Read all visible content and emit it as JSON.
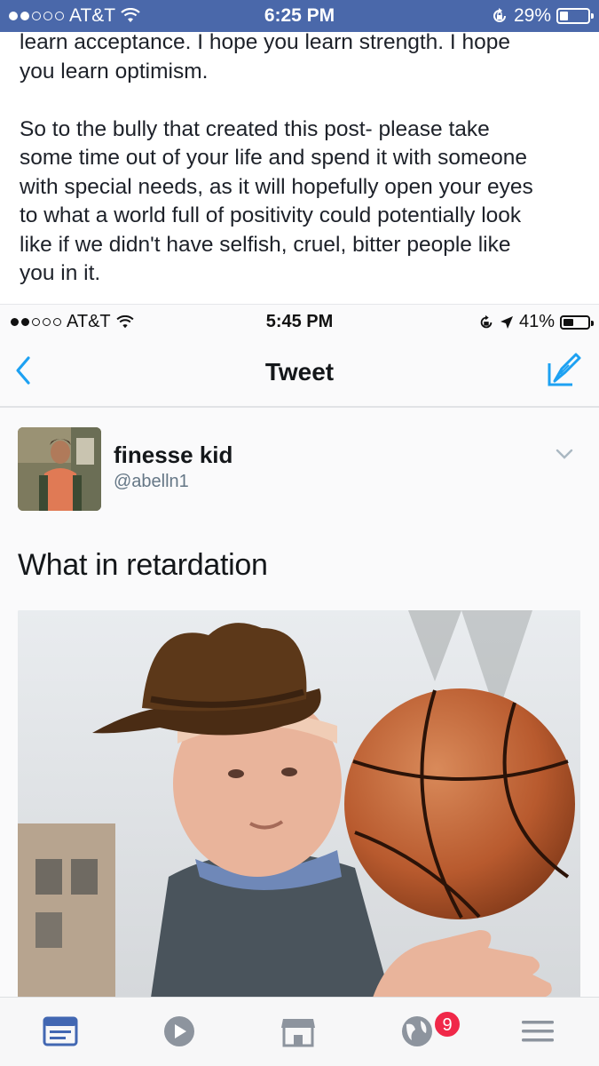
{
  "outer_status": {
    "carrier": "AT&T",
    "time": "6:25 PM",
    "battery_text": "29%",
    "battery_level": 0.29
  },
  "post": {
    "text": "learn acceptance. I hope you learn strength. I hope\nyou learn optimism.\n\nSo to the bully that created this post- please take\nsome time out of your life and spend it with someone\nwith special needs, as it will hopefully open your eyes\nto what a world full of positivity could potentially look\nlike if we didn't have selfish, cruel, bitter people like\nyou in it."
  },
  "inner_status": {
    "carrier": "AT&T",
    "time": "5:45 PM",
    "battery_text": "41%",
    "battery_level": 0.41
  },
  "tweet_view": {
    "nav_title": "Tweet",
    "author_name": "finesse kid",
    "author_handle": "@abelln1",
    "tweet_text": "What in retardation"
  },
  "tabbar": {
    "items": [
      {
        "icon": "news-feed-icon",
        "active": true
      },
      {
        "icon": "video-play-icon",
        "active": false
      },
      {
        "icon": "marketplace-icon",
        "active": false
      },
      {
        "icon": "notifications-globe-icon",
        "active": false
      },
      {
        "icon": "menu-icon",
        "active": false
      }
    ],
    "notifications_badge": "9"
  },
  "colors": {
    "facebook_blue": "#4a68aa",
    "twitter_blue": "#1da1f2",
    "badge_red": "#f02849"
  }
}
